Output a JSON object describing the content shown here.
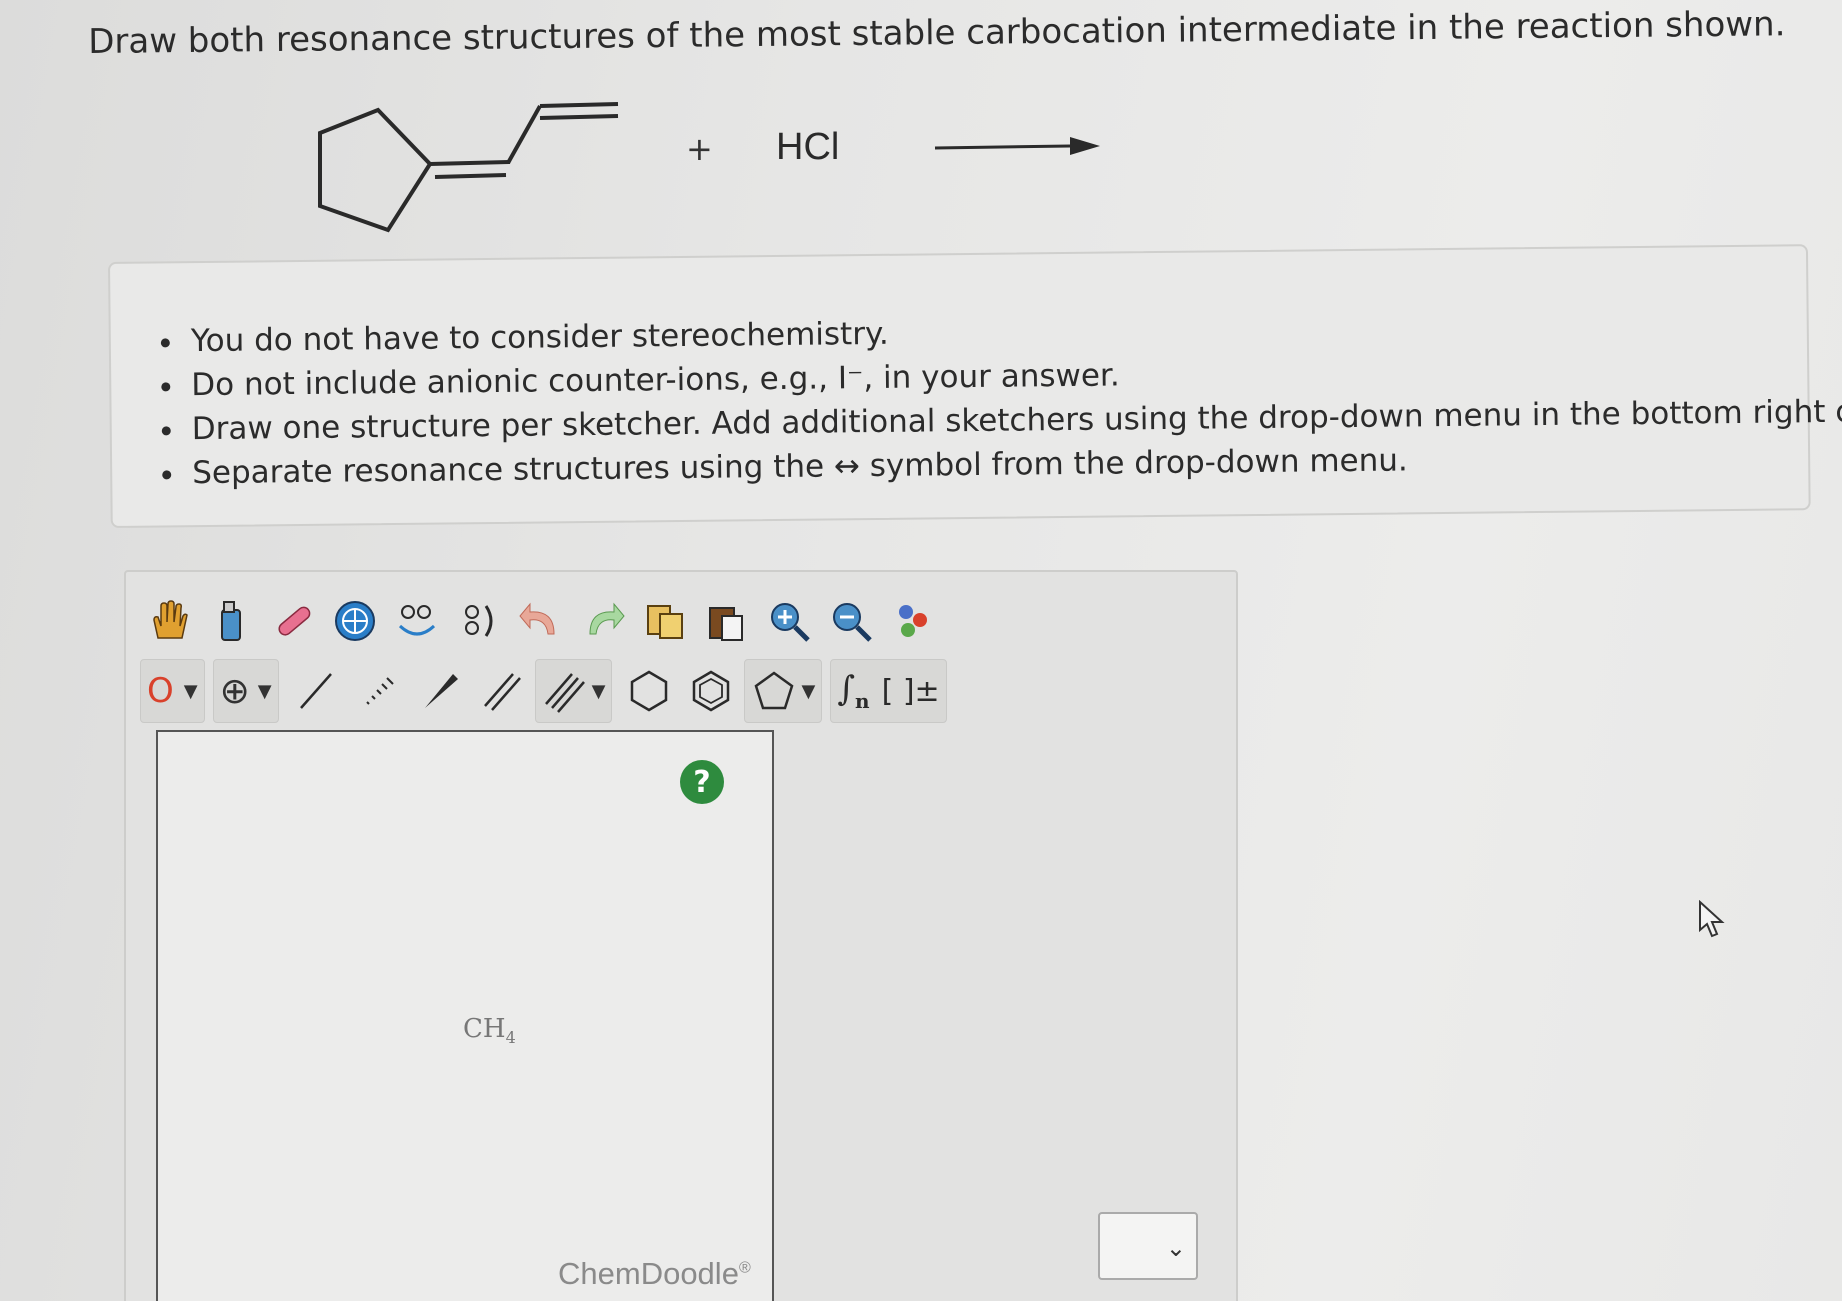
{
  "question": "Draw both resonance structures of the most stable carbocation intermediate in the reaction shown.",
  "reaction": {
    "plus": "+",
    "reagent": "HCl"
  },
  "instructions": [
    "You do not have to consider stereochemistry.",
    "Do not include anionic counter-ions, e.g., I⁻, in your answer.",
    "Draw one structure per sketcher. Add additional sketchers using the drop-down menu in the bottom right corner.",
    "Separate resonance structures using the ↔ symbol from the drop-down menu."
  ],
  "toolbar": {
    "row1": [
      "hand-icon",
      "clear-icon",
      "eraser-icon",
      "center-icon",
      "clean-icon",
      "flip-icon",
      "undo-icon",
      "redo-icon",
      "copy-icon",
      "paste-icon",
      "zoom-in-icon",
      "zoom-out-icon",
      "atom-icon"
    ],
    "atom_label": "O",
    "charge_label": "⊕",
    "bracket_label": "[ ]±",
    "repeat_label": "n"
  },
  "sketcher": {
    "help_label": "?",
    "canvas_text": "CH",
    "canvas_sub": "4",
    "watermark": "ChemDoodle",
    "watermark_mark": "®"
  },
  "colors": {
    "help_green": "#2e8b3e",
    "atom_red": "#d9412b"
  }
}
